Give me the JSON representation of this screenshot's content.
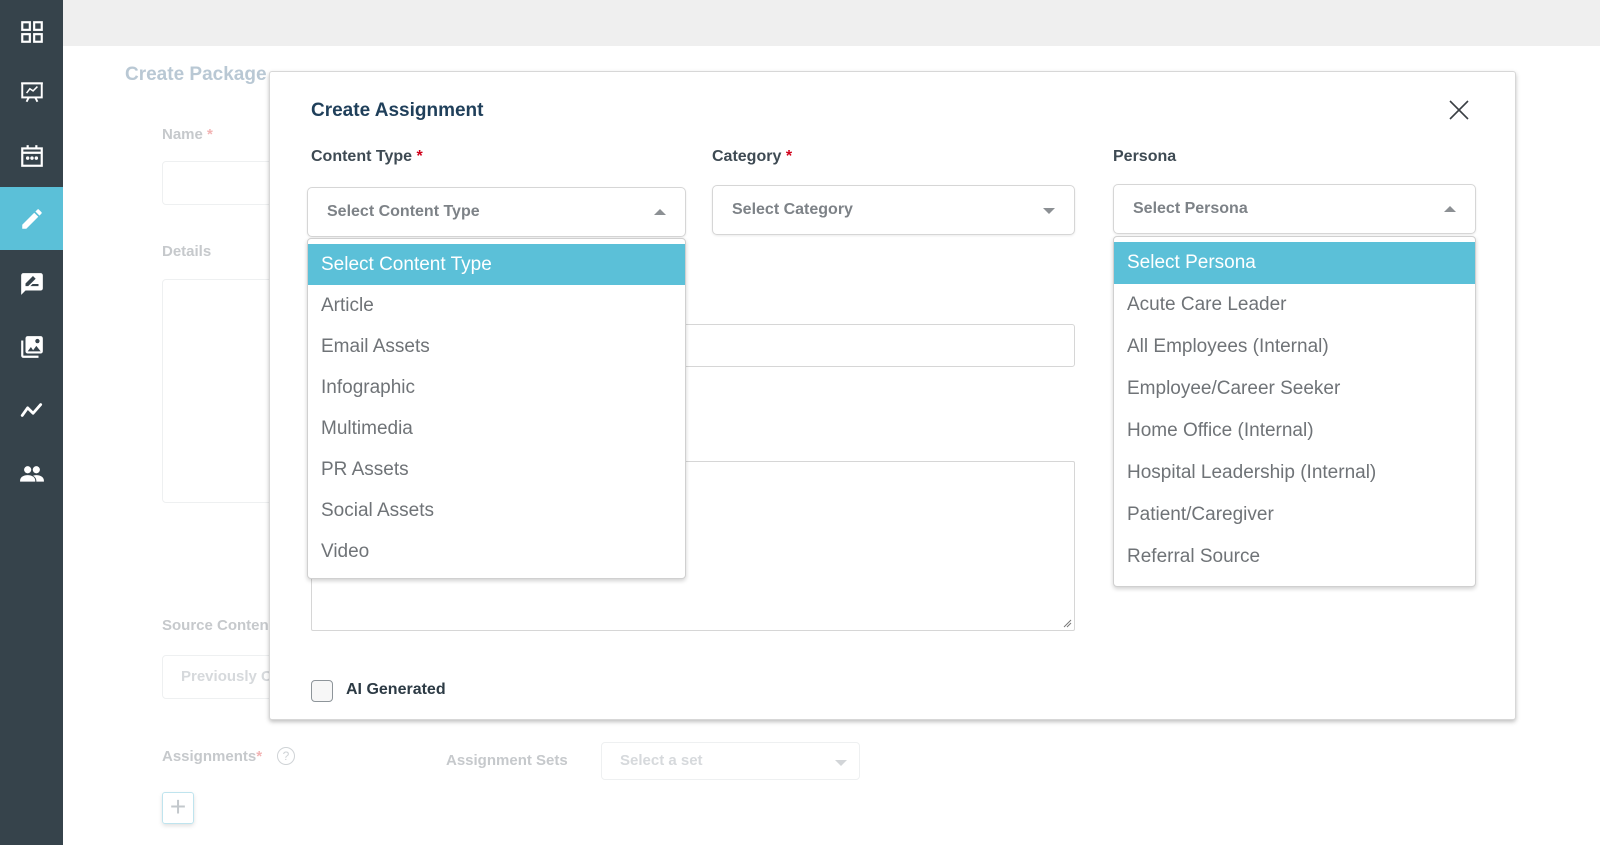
{
  "sidebar": {
    "items": [
      {
        "name": "dashboard",
        "icon": "grid-icon",
        "active": false
      },
      {
        "name": "presentations",
        "icon": "presentation-board-icon",
        "active": false
      },
      {
        "name": "calendar",
        "icon": "calendar-icon",
        "active": false
      },
      {
        "name": "create",
        "icon": "pencil-icon",
        "active": true
      },
      {
        "name": "review",
        "icon": "comment-edit-icon",
        "active": false
      },
      {
        "name": "media",
        "icon": "image-gallery-icon",
        "active": false
      },
      {
        "name": "analytics",
        "icon": "trend-line-icon",
        "active": false
      },
      {
        "name": "users",
        "icon": "users-icon",
        "active": false
      }
    ]
  },
  "background_form": {
    "title": "Create Package",
    "name_label": "Name",
    "required_mark": "*",
    "details_label": "Details",
    "source_content_label": "Source Conten",
    "source_content_placeholder": "Previously C",
    "assignments_label": "Assignments",
    "help_icon": "?",
    "assignment_sets_label": "Assignment Sets",
    "assignment_sets_placeholder": "Select a set",
    "add_button": "+"
  },
  "modal": {
    "title": "Create Assignment",
    "close_icon": "close-icon",
    "content_type": {
      "label": "Content Type",
      "required_mark": "*",
      "selected": "Select Content Type",
      "expanded": true,
      "options": [
        "Select Content Type",
        "Article",
        "Email Assets",
        "Infographic",
        "Multimedia",
        "PR Assets",
        "Social Assets",
        "Video"
      ]
    },
    "category": {
      "label": "Category",
      "required_mark": "*",
      "selected": "Select Category",
      "expanded": false
    },
    "persona": {
      "label": "Persona",
      "selected": "Select Persona",
      "expanded": true,
      "options": [
        "Select Persona",
        "Acute Care Leader",
        "All Employees (Internal)",
        "Employee/Career Seeker",
        "Home Office (Internal)",
        "Hospital Leadership (Internal)",
        "Patient/Caregiver",
        "Referral Source"
      ]
    },
    "ai_generated": {
      "label": "AI Generated",
      "checked": false
    }
  },
  "colors": {
    "sidebar_bg": "#36434b",
    "accent": "#5bc0d8",
    "required": "#d0021b",
    "title": "#1f3f5a"
  }
}
